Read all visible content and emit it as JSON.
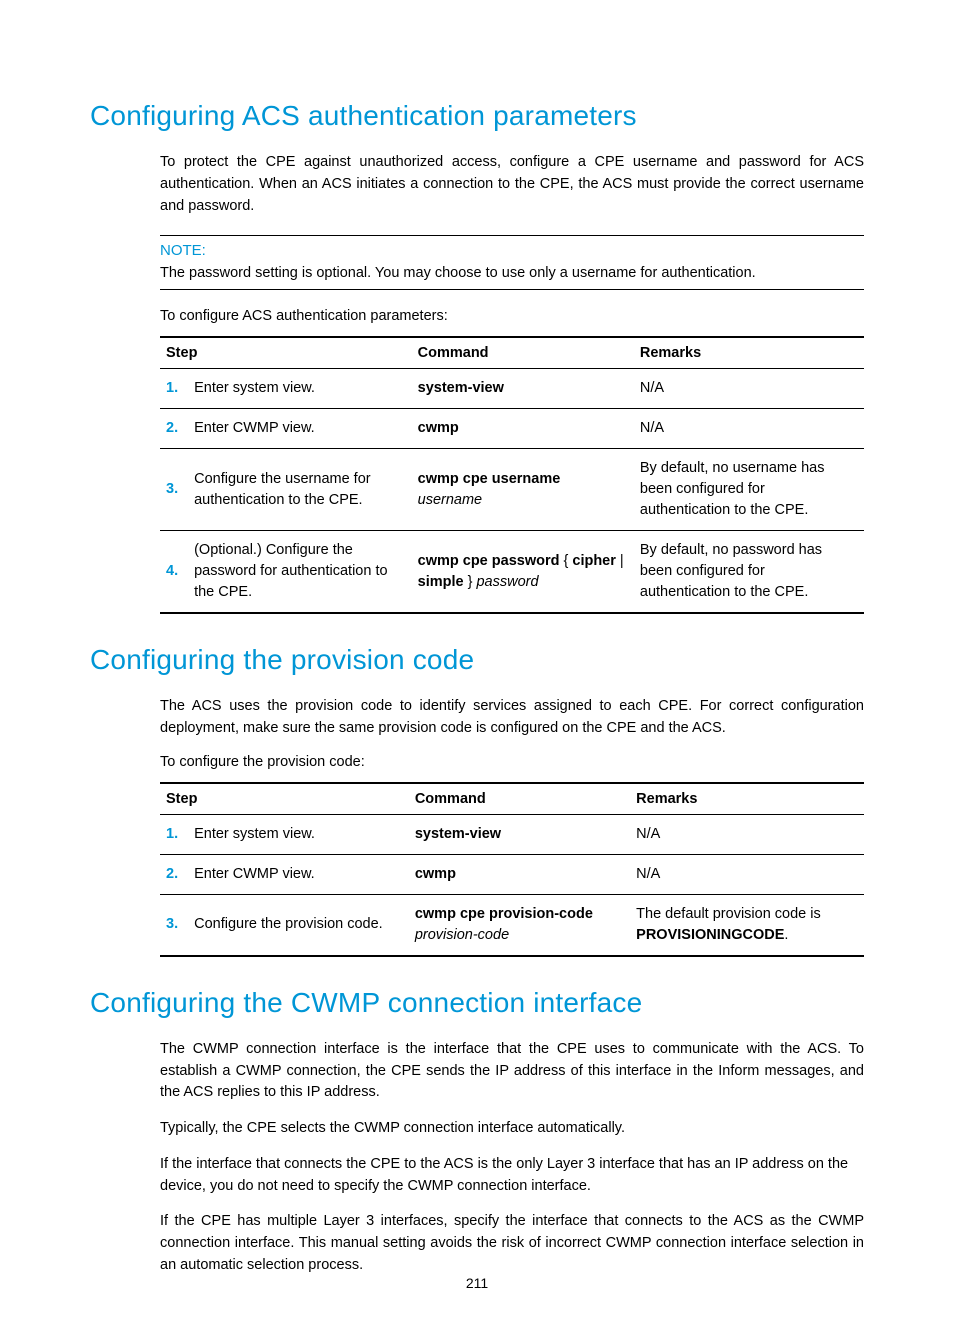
{
  "page_number": "211",
  "section1": {
    "heading": "Configuring ACS authentication parameters",
    "para1": "To protect the CPE against unauthorized access, configure a CPE username and password for ACS authentication. When an ACS initiates a connection to the CPE, the ACS must provide the correct username and password.",
    "note_label": "NOTE:",
    "note_text": "The password setting is optional. You may choose to use only a username for authentication.",
    "lead_in": "To configure ACS authentication parameters:",
    "table": {
      "headers": {
        "step": "Step",
        "command": "Command",
        "remarks": "Remarks"
      },
      "rows": [
        {
          "num": "1.",
          "step": "Enter system view.",
          "cmd_b1": "system-view",
          "remarks": "N/A"
        },
        {
          "num": "2.",
          "step": "Enter CWMP view.",
          "cmd_b1": "cwmp",
          "remarks": "N/A"
        },
        {
          "num": "3.",
          "step": "Configure the username for authentication to the CPE.",
          "cmd_b1": "cwmp cpe username ",
          "cmd_i1": "username",
          "remarks": "By default, no username has been configured for authentication to the CPE."
        },
        {
          "num": "4.",
          "step": "(Optional.) Configure the password for authentication to the CPE.",
          "cmd_b1": "cwmp cpe password ",
          "cmd_t1": "{ ",
          "cmd_b2": "cipher",
          "cmd_t2": " | ",
          "cmd_b3": "simple",
          "cmd_t3": " } ",
          "cmd_i1": "password",
          "remarks": "By default, no password has been configured for authentication to the CPE."
        }
      ]
    }
  },
  "section2": {
    "heading": "Configuring the provision code",
    "para1": "The ACS uses the provision code to identify services assigned to each CPE. For correct configuration deployment, make sure the same provision code is configured on the CPE and the ACS.",
    "lead_in": "To configure the provision code:",
    "table": {
      "headers": {
        "step": "Step",
        "command": "Command",
        "remarks": "Remarks"
      },
      "rows": [
        {
          "num": "1.",
          "step": "Enter system view.",
          "cmd_b1": "system-view",
          "remarks": "N/A"
        },
        {
          "num": "2.",
          "step": "Enter CWMP view.",
          "cmd_b1": "cwmp",
          "remarks": "N/A"
        },
        {
          "num": "3.",
          "step": "Configure the provision code.",
          "cmd_b1": "cwmp cpe provision-code ",
          "cmd_i1": "provision-code",
          "remarks_pre": "The default provision code is ",
          "remarks_bold": "PROVISIONINGCODE",
          "remarks_post": "."
        }
      ]
    }
  },
  "section3": {
    "heading": "Configuring the CWMP connection interface",
    "para1": "The CWMP connection interface is the interface that the CPE uses to communicate with the ACS. To establish a CWMP connection, the CPE sends the IP address of this interface in the Inform messages, and the ACS replies to this IP address.",
    "para2": "Typically, the CPE selects the CWMP connection interface automatically.",
    "para3": "If the interface that connects the CPE to the ACS is the only Layer 3 interface that has an IP address on the device, you do not need to specify the CWMP connection interface.",
    "para4": "If the CPE has multiple Layer 3 interfaces, specify the interface that connects to the ACS as the CWMP connection interface. This manual setting avoids the risk of incorrect CWMP connection interface selection in an automatic selection process."
  }
}
